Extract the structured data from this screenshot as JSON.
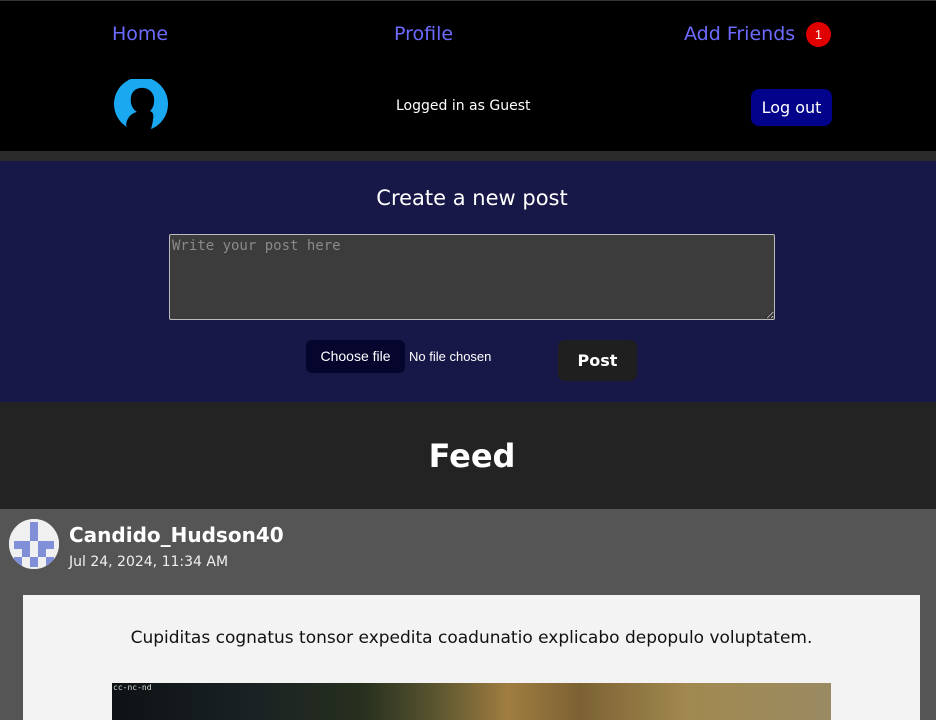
{
  "nav": {
    "home": "Home",
    "profile": "Profile",
    "add_friends": "Add Friends",
    "friend_badge": "1",
    "logged_in_text": "Logged in as Guest",
    "logout": "Log out"
  },
  "create_post": {
    "title": "Create a new post",
    "placeholder": "Write your post here",
    "choose_file": "Choose file",
    "no_file": "No file chosen",
    "post_button": "Post"
  },
  "feed": {
    "title": "Feed",
    "posts": [
      {
        "author": "Candido_Hudson40",
        "date": "Jul 24, 2024, 11:34 AM",
        "text": "Cupiditas cognatus tonsor expedita coadunatio explicabo depopulo voluptatem.",
        "image_label": "cc-nc-nd"
      }
    ]
  },
  "colors": {
    "nav_bg": "#000000",
    "nav_link": "#6d6bff",
    "badge": "#e00000",
    "logout_bg": "#02028a",
    "create_bg": "#181848",
    "feed_header_bg": "#232323",
    "post_card_bg": "#555555"
  },
  "icons": {
    "nav_avatar": "user-silhouette-icon",
    "author_avatar": "identicon-avatar"
  }
}
